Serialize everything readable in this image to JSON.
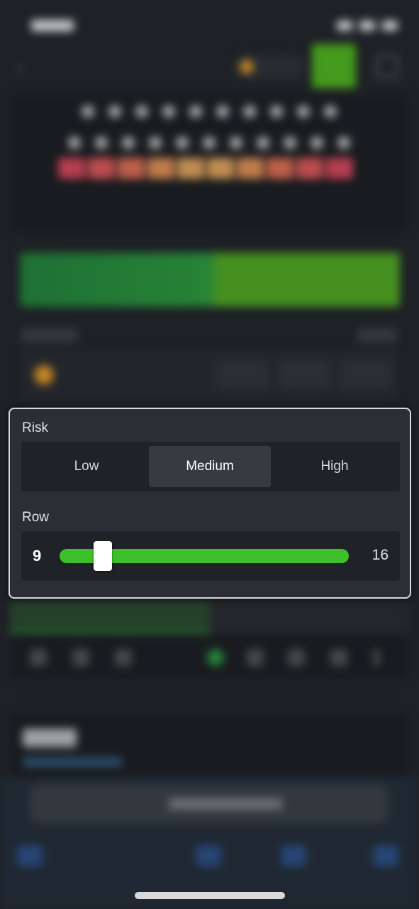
{
  "risk_panel": {
    "risk_label": "Risk",
    "risk_options": [
      "Low",
      "Medium",
      "High"
    ],
    "selected_risk": "Medium",
    "row_label": "Row",
    "row_min": "9",
    "row_max": "16",
    "row_value_fraction": 0.15
  },
  "colors": {
    "accent_green": "#3ec02a",
    "bet_green": "#52b51e",
    "panel_bg": "#2b2f35"
  },
  "icons": [
    "back-arrow-icon",
    "coin-icon",
    "box-icon"
  ]
}
